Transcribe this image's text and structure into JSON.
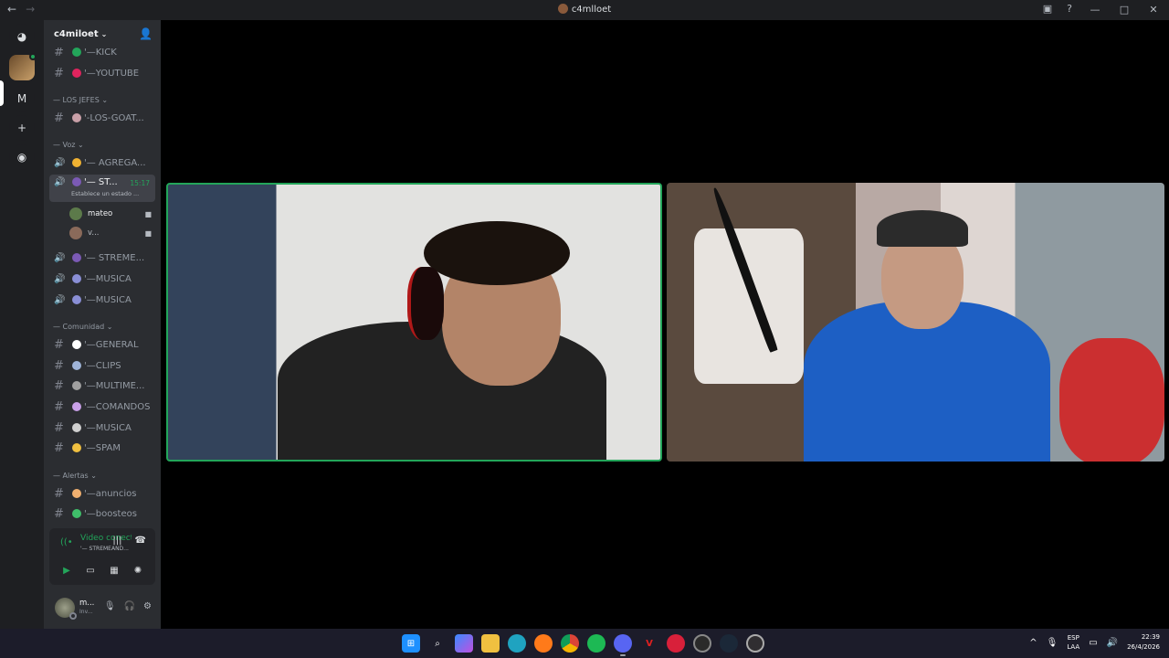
{
  "window": {
    "title": "c4mlloet",
    "nav_back": "←",
    "nav_forward": "→",
    "icons": [
      "inbox-icon",
      "help-icon"
    ],
    "inbox_glyph": "▣",
    "help_glyph": "?",
    "min_glyph": "—",
    "max_glyph": "□",
    "close_glyph": "✕"
  },
  "guilds": {
    "home_glyph": "◕",
    "server_letter": "M",
    "add_glyph": "+",
    "discover_glyph": "◉"
  },
  "server": {
    "name": "c4miloet",
    "caret": "⌄",
    "invite_glyph": "👤"
  },
  "channels": {
    "kick": "'—KICK",
    "youtube": "'—YOUTUBE",
    "cat_jefes": "— LOS JEFES ⌄",
    "los_goat": "'-LOS-GOAT...",
    "cat_voz": "— Voz ⌄",
    "agrega": "'— AGREGA...",
    "active_name": "'— ST...",
    "active_sub": "Establece un estado ...",
    "active_timer": "15:17",
    "user1": "mateo",
    "user2": "v...",
    "streme": "'— STREME...",
    "musica1": "'—MUSICA",
    "musica2": "'—MUSICA",
    "cat_comunidad": "— Comunidad ⌄",
    "general": "'—GENERAL",
    "clips": "'—CLIPS",
    "multime": "'—MULTIME...",
    "comandos": "'—COMANDOS",
    "musica3": "'—MUSICA",
    "spam": "'—SPAM",
    "cat_alertas": "— Alertas ⌄",
    "anuncios": "'—anuncios",
    "boosteos": "'—boosteos",
    "hash": "#",
    "speaker": "🔊",
    "cam": "■"
  },
  "voice": {
    "status": "Video conectado",
    "channel": "'— STREMEAND...",
    "signal_glyph": "((•",
    "soundboard_glyph": "|||",
    "disconnect_glyph": "☎",
    "btn_camera": "▶",
    "btn_screen": "▭",
    "btn_activities": "▦",
    "btn_effects": "✺"
  },
  "user_panel": {
    "name": "m...",
    "status": "Inv...",
    "mic_glyph": "🎙",
    "headset_glyph": "🎧",
    "settings_glyph": "⚙",
    "caret": "⌄"
  },
  "taskbar": {
    "apps": [
      "windows-start",
      "search",
      "copilot",
      "file-explorer",
      "edge",
      "firefox",
      "chrome",
      "spotify",
      "discord",
      "app-red",
      "app-target",
      "app-steam-alt",
      "steam",
      "obs"
    ],
    "lang_top": "ESP",
    "lang_bottom": "LAA",
    "time": "22:39",
    "date": "26/4/2026",
    "tray_up": "^",
    "mic_glyph": "🎙",
    "monitor_glyph": "▭",
    "volume_glyph": "🔊"
  },
  "colors": {
    "accent_green": "#23a55a",
    "sidebar": "#2b2d31",
    "guild_bar": "#1e1f22"
  }
}
